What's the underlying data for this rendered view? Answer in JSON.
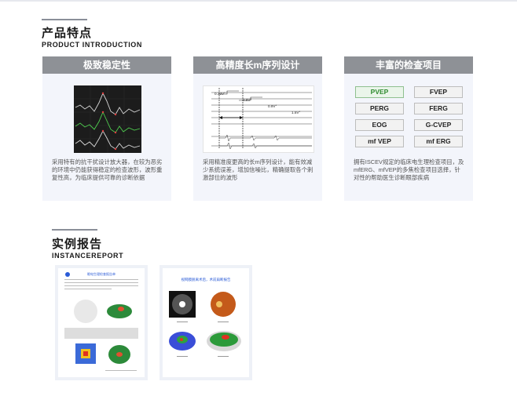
{
  "sections": {
    "features": {
      "title": "产品特点",
      "subtitle": "PRODUCT INTRODUCTION"
    },
    "reports": {
      "title": "实例报告",
      "subtitle": "INSTANCEREPORT"
    }
  },
  "cards": [
    {
      "title": "极致稳定性",
      "description": "采用特有的抗干扰设计放大器，在较为恶劣的环境中仍能获得稳定的检查波形，波形重复性高，为临床提供可靠的诊断依据"
    },
    {
      "title": "高精度长m序列设计",
      "description": "采用精准度更高的长m序列设计，能有效减少系统误差，增加信噪比，精确提取各个刺激部位的波形",
      "chart_labels": [
        "0.33V°",
        "0.8V°",
        "0.9V°",
        "1.5V°"
      ]
    },
    {
      "title": "丰富的检查项目",
      "description": "拥有ISCEV规定的临床电生理检查项目，及mfERG、mfVEP的多焦检查项目选择，针对性的帮助医生诊断眼部疾病",
      "tests": [
        "PVEP",
        "FVEP",
        "PERG",
        "FERG",
        "EOG",
        "G-CVEP",
        "mf VEP",
        "mf ERG"
      ]
    }
  ],
  "reports": [
    {
      "header": "眼电生理检查报告单"
    },
    {
      "header": "视网膜脱离术后，术前扁断报告"
    }
  ],
  "colors": {
    "header_gray": "#8e9196",
    "card_bg": "#f3f5fb",
    "pvep_green": "#2e8b2e"
  }
}
